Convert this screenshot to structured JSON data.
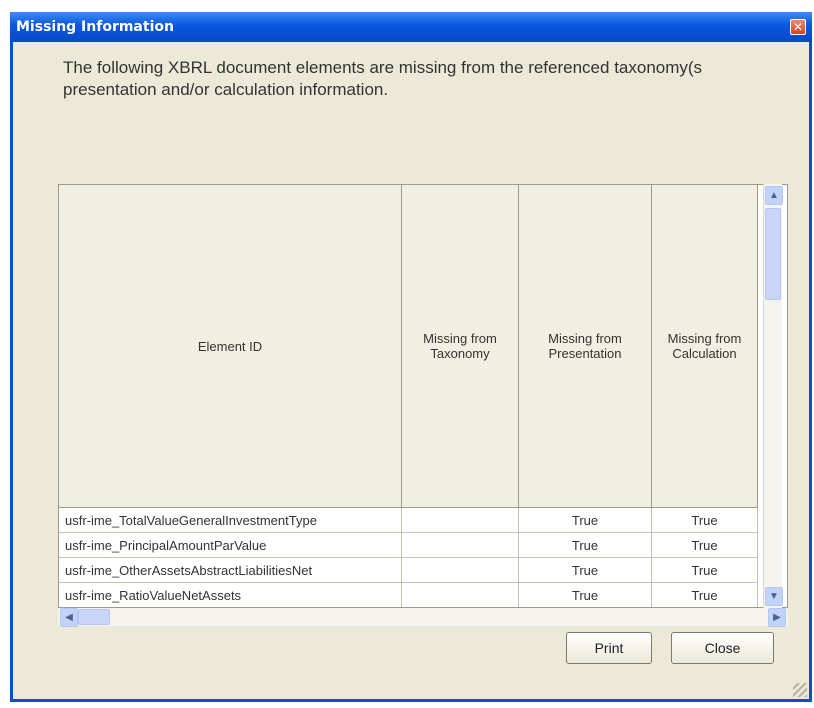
{
  "window": {
    "title": "Missing Information",
    "close_glyph": "✕"
  },
  "message": {
    "line1": "The following XBRL document elements are missing from the referenced taxonomy(s",
    "line2": "presentation and/or calculation information."
  },
  "table": {
    "headers": [
      "Element ID",
      "Missing from Taxonomy",
      "Missing from Presentation",
      "Missing from Calculation"
    ],
    "rows": [
      [
        "usfr-ime_TotalValueGeneralInvestmentType",
        "",
        "True",
        "True"
      ],
      [
        "usfr-ime_PrincipalAmountParValue",
        "",
        "True",
        "True"
      ],
      [
        "usfr-ime_OtherAssetsAbstractLiabilitiesNet",
        "",
        "True",
        "True"
      ],
      [
        "usfr-ime_RatioValueNetAssets",
        "",
        "True",
        "True"
      ]
    ]
  },
  "buttons": {
    "print": "Print",
    "close": "Close"
  },
  "icons": {
    "up": "scroll-up-icon",
    "down": "scroll-down-icon",
    "left": "scroll-left-icon",
    "right": "scroll-right-icon"
  }
}
